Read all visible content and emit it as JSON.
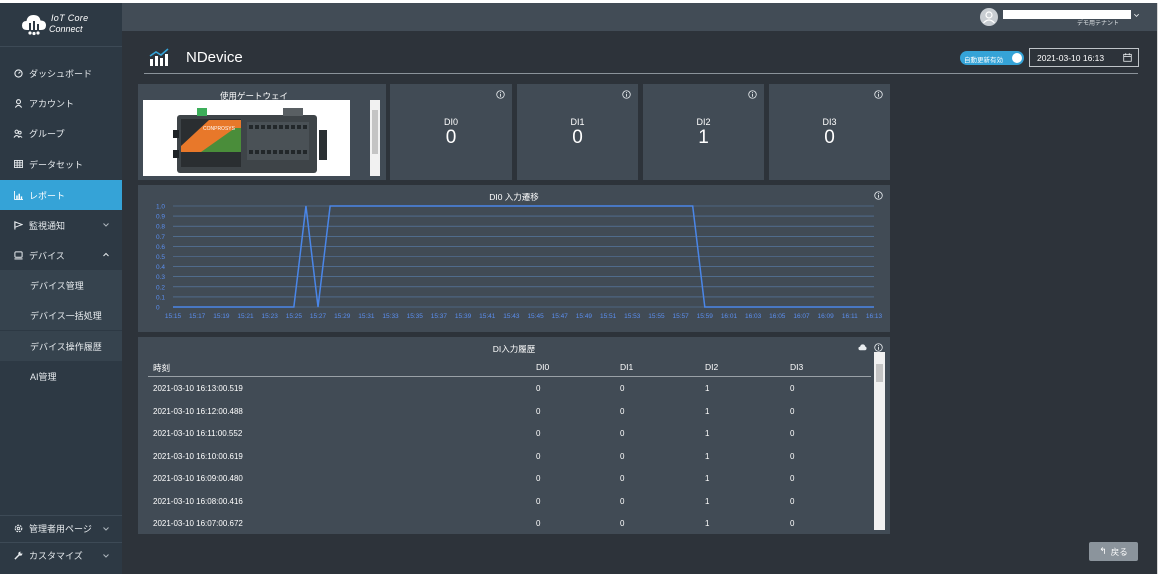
{
  "app": {
    "logo_line1": "IoT Core",
    "logo_line2": "Connect"
  },
  "user": {
    "tenant": "デモ用テナント"
  },
  "sidebar": {
    "items": [
      {
        "label": "ダッシュボード",
        "icon": "dashboard-icon"
      },
      {
        "label": "アカウント",
        "icon": "user-icon"
      },
      {
        "label": "グループ",
        "icon": "group-icon"
      },
      {
        "label": "データセット",
        "icon": "table-icon"
      },
      {
        "label": "レポート",
        "icon": "bar-chart-icon"
      },
      {
        "label": "監視通知",
        "icon": "flag-icon"
      },
      {
        "label": "デバイス",
        "icon": "device-icon"
      }
    ],
    "sub_items": [
      "デバイス管理",
      "デバイス一括処理",
      "デバイス操作履歴"
    ],
    "extra_item": "AI管理",
    "bottom_items": [
      {
        "label": "管理者用ページ",
        "icon": "gear-icon"
      },
      {
        "label": "カスタマイズ",
        "icon": "wrench-icon"
      }
    ]
  },
  "page": {
    "title": "NDevice",
    "auto_update_label": "自動更新有効",
    "datetime": "2021-03-10 16:13",
    "back_label": "戻る"
  },
  "gateway": {
    "title": "使用ゲートウェイ",
    "image_brand": "CONPROSYS"
  },
  "di_cards": [
    {
      "label": "DI0",
      "value": "0"
    },
    {
      "label": "DI1",
      "value": "0"
    },
    {
      "label": "DI2",
      "value": "1"
    },
    {
      "label": "DI3",
      "value": "0"
    }
  ],
  "chart_data": {
    "type": "line",
    "title": "DI0 入力遷移",
    "x": [
      "15:15",
      "15:17",
      "15:19",
      "15:21",
      "15:23",
      "15:25",
      "15:27",
      "15:29",
      "15:31",
      "15:33",
      "15:35",
      "15:37",
      "15:39",
      "15:41",
      "15:43",
      "15:45",
      "15:47",
      "15:49",
      "15:51",
      "15:53",
      "15:55",
      "15:57",
      "15:59",
      "16:01",
      "16:03",
      "16:05",
      "16:07",
      "16:09",
      "16:11",
      "16:13"
    ],
    "y_ticks": [
      "0",
      "0.1",
      "0.2",
      "0.3",
      "0.4",
      "0.5",
      "0.6",
      "0.7",
      "0.8",
      "0.9",
      "1.0"
    ],
    "ylim": [
      0,
      1
    ],
    "grid": true,
    "series": [
      {
        "color": "#4a86e8",
        "points": [
          [
            "15:15",
            0
          ],
          [
            "15:25",
            0
          ],
          [
            "15:26",
            1
          ],
          [
            "15:27",
            0
          ],
          [
            "15:28",
            1
          ],
          [
            "15:58",
            1
          ],
          [
            "15:59",
            0
          ],
          [
            "16:13",
            0
          ]
        ]
      }
    ]
  },
  "history": {
    "title": "DI入力履歴",
    "columns": [
      "時刻",
      "DI0",
      "DI1",
      "DI2",
      "DI3"
    ],
    "rows": [
      [
        "2021-03-10 16:13:00.519",
        "0",
        "0",
        "1",
        "0"
      ],
      [
        "2021-03-10 16:12:00.488",
        "0",
        "0",
        "1",
        "0"
      ],
      [
        "2021-03-10 16:11:00.552",
        "0",
        "0",
        "1",
        "0"
      ],
      [
        "2021-03-10 16:10:00.619",
        "0",
        "0",
        "1",
        "0"
      ],
      [
        "2021-03-10 16:09:00.480",
        "0",
        "0",
        "1",
        "0"
      ],
      [
        "2021-03-10 16:08:00.416",
        "0",
        "0",
        "1",
        "0"
      ],
      [
        "2021-03-10 16:07:00.672",
        "0",
        "0",
        "1",
        "0"
      ]
    ]
  }
}
